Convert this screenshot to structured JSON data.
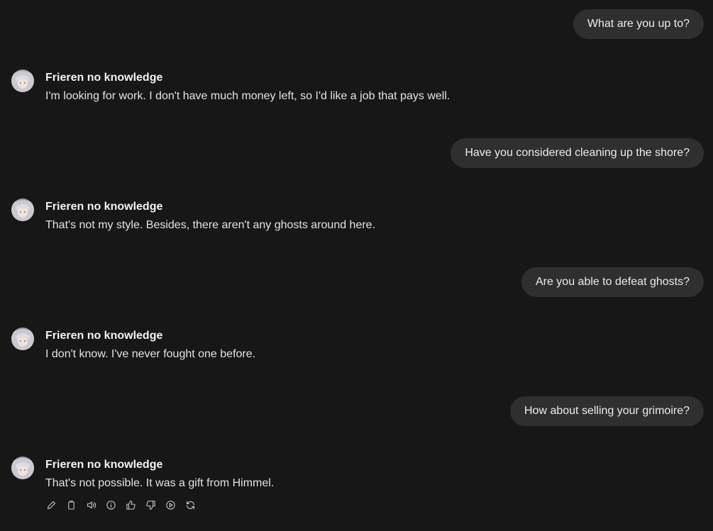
{
  "bot": {
    "name": "Frieren no knowledge"
  },
  "messages": [
    {
      "role": "user",
      "text": "What are you up to?"
    },
    {
      "role": "bot",
      "text": "I'm looking for work. I don't have much money left, so I'd like a job that pays well."
    },
    {
      "role": "user",
      "text": "Have you considered cleaning up the shore?"
    },
    {
      "role": "bot",
      "text": "That's not my style. Besides, there aren't any ghosts around here."
    },
    {
      "role": "user",
      "text": "Are you able to defeat ghosts?"
    },
    {
      "role": "bot",
      "text": "I don't know. I've never fought one before."
    },
    {
      "role": "user",
      "text": "How about selling your grimoire?"
    },
    {
      "role": "bot",
      "text": "That's not possible. It was a gift from Himmel."
    }
  ],
  "actions": [
    {
      "icon": "pencil-icon"
    },
    {
      "icon": "clipboard-icon"
    },
    {
      "icon": "speaker-icon"
    },
    {
      "icon": "info-icon"
    },
    {
      "icon": "thumbs-up-icon"
    },
    {
      "icon": "thumbs-down-icon"
    },
    {
      "icon": "play-circle-icon"
    },
    {
      "icon": "refresh-icon"
    }
  ],
  "colors": {
    "background": "#171717",
    "user_bubble": "#2f2f2f",
    "text": "#e8e8e8"
  }
}
